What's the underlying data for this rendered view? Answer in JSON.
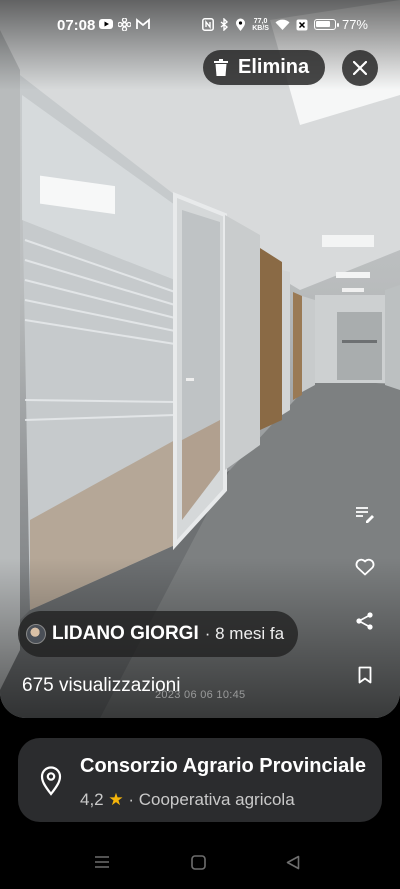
{
  "status_bar": {
    "time": "07:08",
    "speed_value": "77,0",
    "speed_unit": "KB/S",
    "battery": "77%"
  },
  "actions": {
    "delete_label": "Elimina"
  },
  "photo": {
    "author": "LIDANO GIORGI",
    "time_ago": "· 8 mesi fa",
    "views": "675 visualizzazioni",
    "timestamp": "2023 06 06 10:45"
  },
  "place": {
    "name": "Consorzio Agrario Provinciale",
    "rating": "4,2",
    "category": "· Cooperativa agricola"
  },
  "colors": {
    "card_bg": "#2b2c2e",
    "star": "#f5b50a"
  }
}
